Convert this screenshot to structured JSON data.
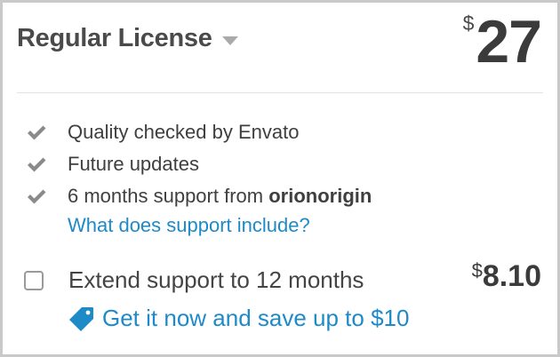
{
  "license": {
    "title": "Regular License",
    "currency": "$",
    "price": "27"
  },
  "features": [
    {
      "text": "Quality checked by Envato",
      "bold": ""
    },
    {
      "text": "Future updates",
      "bold": ""
    },
    {
      "text": "6 months support from ",
      "bold": "orionorigin"
    }
  ],
  "support_link": "What does support include?",
  "extend": {
    "label": "Extend support to 12 months",
    "checked": false,
    "currency": "$",
    "price": "8.10",
    "save_link": "Get it now and save up to $10"
  },
  "colors": {
    "link": "#1e8ac7",
    "check": "#8a8a8a",
    "border": "#c9c9c9"
  },
  "icons": {
    "dropdown": "caret-down-icon",
    "feature": "checkmark-icon",
    "save": "price-tag-icon"
  }
}
